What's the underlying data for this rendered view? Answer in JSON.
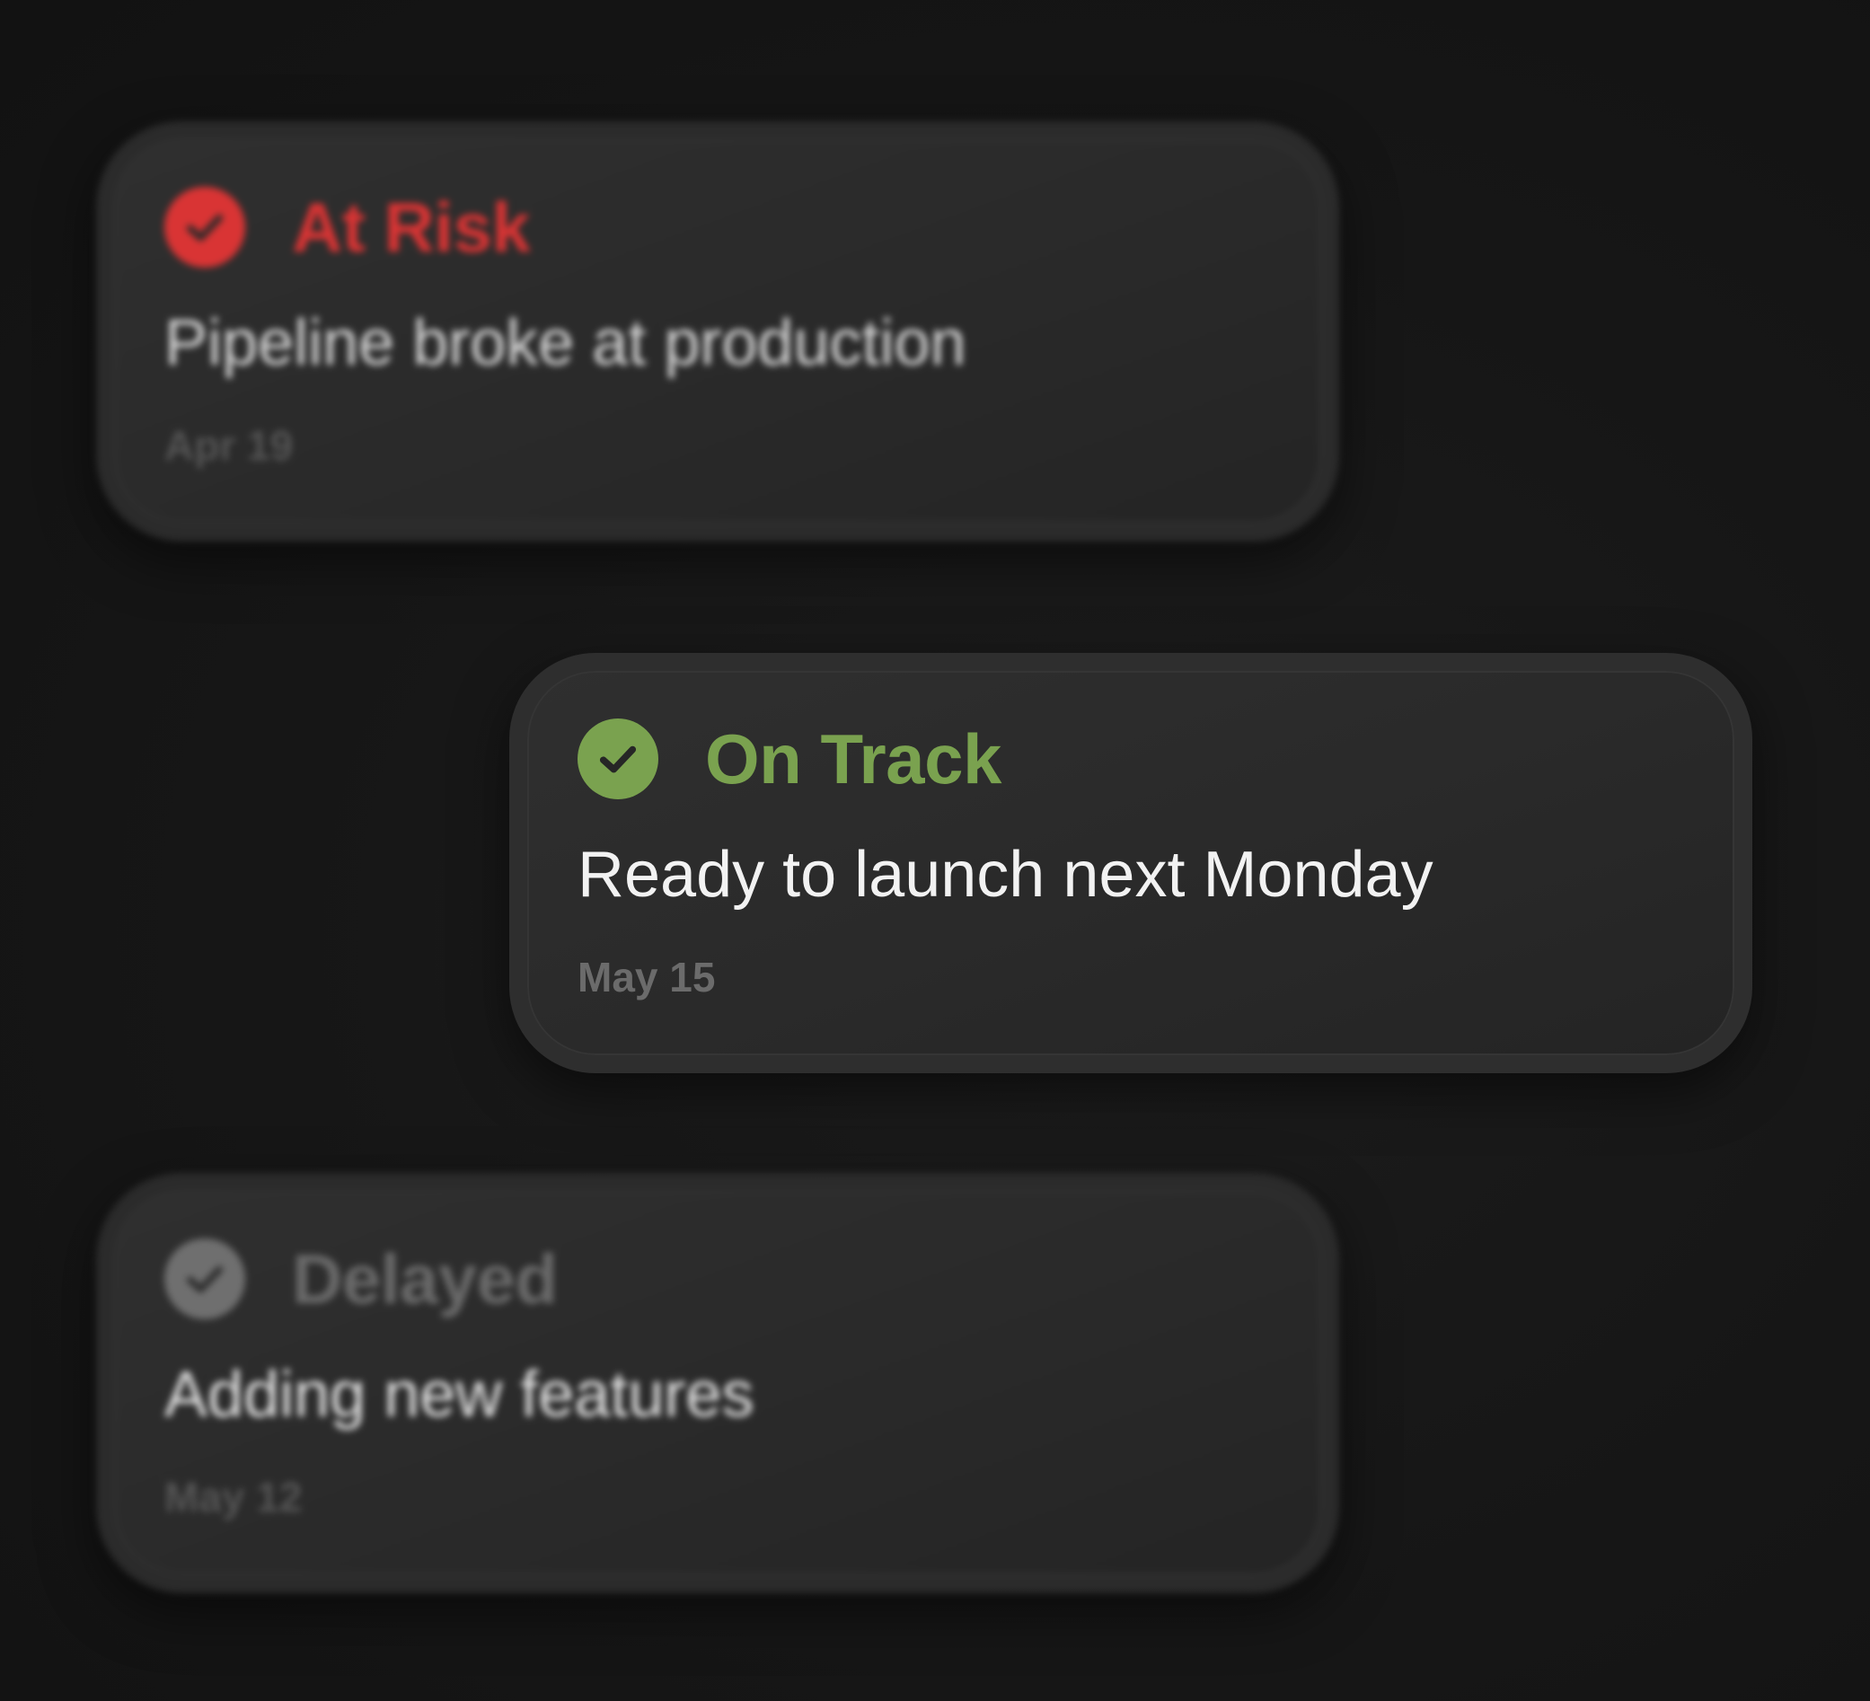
{
  "cards": [
    {
      "status": "At Risk",
      "message": "Pipeline broke at production",
      "date": "Apr 19",
      "color": "#d93434",
      "icon": "check-circle-icon"
    },
    {
      "status": "On Track",
      "message": "Ready to launch next Monday",
      "date": "May 15",
      "color": "#7aa24f",
      "icon": "check-circle-icon"
    },
    {
      "status": "Delayed",
      "message": "Adding new features",
      "date": "May 12",
      "color": "#7a7a7a",
      "icon": "check-circle-icon"
    }
  ]
}
